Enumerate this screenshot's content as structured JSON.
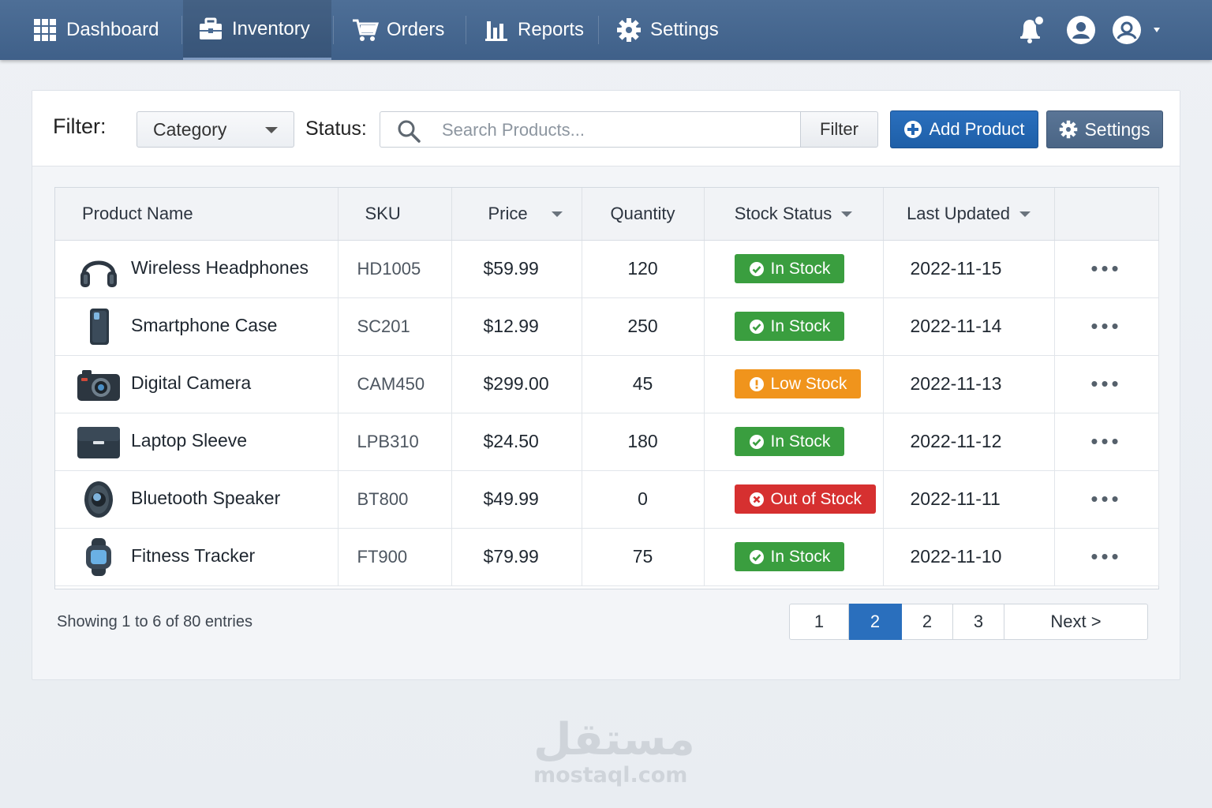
{
  "nav": {
    "items": [
      {
        "label": "Dashboard",
        "icon": "grid-icon"
      },
      {
        "label": "Inventory",
        "icon": "toolbox-icon"
      },
      {
        "label": "Orders",
        "icon": "cart-icon"
      },
      {
        "label": "Reports",
        "icon": "bar-chart-icon"
      },
      {
        "label": "Settings",
        "icon": "gear-icon"
      }
    ],
    "active": "Inventory",
    "right_icons": [
      "bell-icon",
      "user-icon",
      "account-icon"
    ]
  },
  "filterbar": {
    "filter_label": "Filter:",
    "category_value": "Category",
    "status_label": "Status:",
    "search_placeholder": "Search Products...",
    "filter_button": "Filter",
    "add_button": "Add Product",
    "settings_button": "Settings"
  },
  "table": {
    "headers": [
      "Product Name",
      "SKU",
      "Price",
      "Quantity",
      "Stock Status",
      "Last Updated"
    ],
    "rows": [
      {
        "name": "Wireless Headphones",
        "icon": "headphones-icon",
        "sku": "HD1005",
        "price": "$59.99",
        "qty": "120",
        "status": "In Stock",
        "date": "2022-11-15"
      },
      {
        "name": "Smartphone Case",
        "icon": "phone-case-icon",
        "sku": "SC201",
        "price": "$12.99",
        "qty": "250",
        "status": "In Stock",
        "date": "2022-11-14"
      },
      {
        "name": "Digital Camera",
        "icon": "camera-icon",
        "sku": "CAM450",
        "price": "$299.00",
        "qty": "45",
        "status": "Low Stock",
        "date": "2022-11-13"
      },
      {
        "name": "Laptop Sleeve",
        "icon": "laptop-sleeve-icon",
        "sku": "LPB310",
        "price": "$24.50",
        "qty": "180",
        "status": "In Stock",
        "date": "2022-11-12"
      },
      {
        "name": "Bluetooth Speaker",
        "icon": "speaker-icon",
        "sku": "BT800",
        "price": "$49.99",
        "qty": "0",
        "status": "Out of Stock",
        "date": "2022-11-11"
      },
      {
        "name": "Fitness Tracker",
        "icon": "tracker-icon",
        "sku": "FT900",
        "price": "$79.99",
        "qty": "75",
        "status": "In Stock",
        "date": "2022-11-10"
      }
    ],
    "row_menu": "•••"
  },
  "status_colors": {
    "In Stock": "#3a9e3f",
    "Low Stock": "#f0941c",
    "Out of Stock": "#d63030"
  },
  "footer": {
    "showing": "Showing 1 to 6 of 80 entries",
    "pages": [
      "1",
      "2",
      "2",
      "3"
    ],
    "active_page_index": 1,
    "next": "Next >"
  },
  "watermark": {
    "arabic": "مستقل",
    "latin": "mostaql.com"
  }
}
